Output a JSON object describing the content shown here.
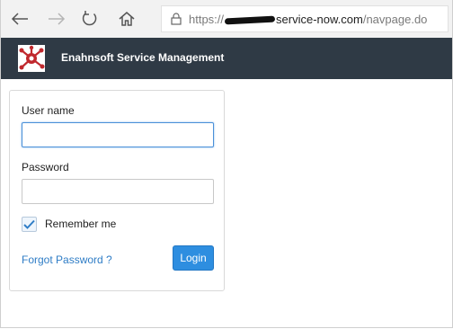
{
  "browser": {
    "url_prefix": "https://",
    "url_domain": "service-now.com",
    "url_path": "/navpage.do"
  },
  "app": {
    "title": "Enahnsoft Service Management",
    "logo_color": "#c0282d"
  },
  "login": {
    "username_label": "User name",
    "username_value": "",
    "password_label": "Password",
    "password_value": "",
    "remember_label": "Remember me",
    "remember_checked": true,
    "forgot_label": "Forgot Password ?",
    "login_button": "Login"
  },
  "colors": {
    "header_bg": "#2f3a45",
    "button_blue": "#2e8ee0",
    "link_blue": "#2f7dc6"
  }
}
